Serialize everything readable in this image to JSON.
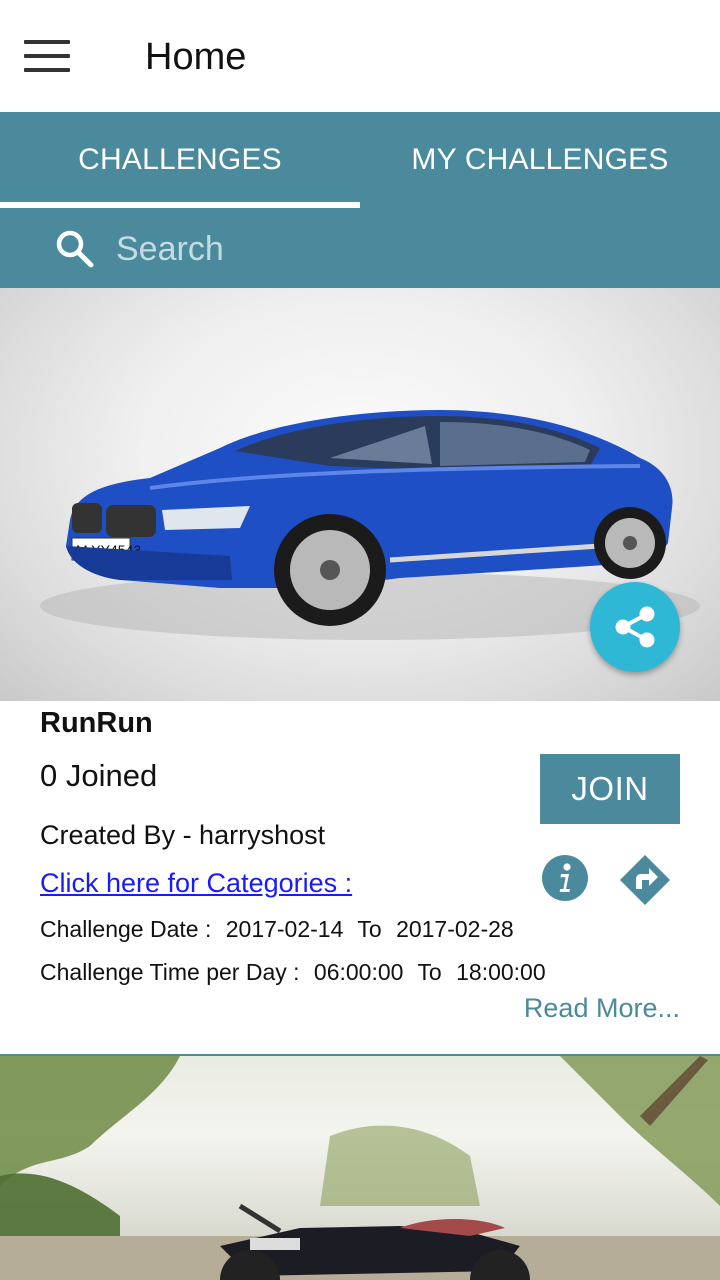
{
  "appbar": {
    "title": "Home"
  },
  "tabs": [
    {
      "label": "CHALLENGES",
      "active": true
    },
    {
      "label": "MY CHALLENGES",
      "active": false
    }
  ],
  "search": {
    "placeholder": "Search",
    "value": ""
  },
  "challenges": [
    {
      "title": "RunRun",
      "joined": "0 Joined",
      "created_by": "Created By - harryshost",
      "categories_link": "Click here for Categories :",
      "date_label": "Challenge Date :",
      "date_from": "2017-02-14",
      "date_to_label": "To",
      "date_to": "2017-02-28",
      "time_label": "Challenge Time per Day :",
      "time_from": "06:00:00",
      "time_to_label": "To",
      "time_to": "18:00:00",
      "join_label": "JOIN",
      "read_more": "Read More..."
    }
  ],
  "colors": {
    "primary": "#4a8a9c",
    "fab": "#2eb8d6",
    "link": "#1a1aff"
  }
}
